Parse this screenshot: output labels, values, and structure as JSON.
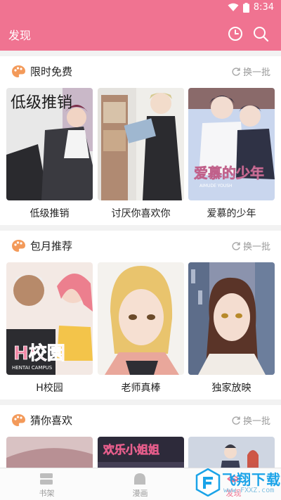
{
  "status": {
    "time": "8:34"
  },
  "app_bar": {
    "title": "发现"
  },
  "sections": [
    {
      "title": "限时免费",
      "refresh_label": "换一批",
      "items": [
        {
          "title": "低级推销",
          "cover_text": "低级推销"
        },
        {
          "title": "讨厌你喜欢你"
        },
        {
          "title": "爱慕的少年",
          "cover_text": "爱慕的少年",
          "cover_subtext": "AIMUDE YOUSH"
        }
      ]
    },
    {
      "title": "包月推荐",
      "refresh_label": "换一批",
      "items": [
        {
          "title": "H校园",
          "cover_text": "H校園",
          "cover_subtext": "HENTAI CAMPUS"
        },
        {
          "title": "老师真棒"
        },
        {
          "title": "独家放映"
        }
      ]
    },
    {
      "title": "猜你喜欢",
      "refresh_label": "换一批",
      "items": [
        {
          "title": ""
        },
        {
          "title": "",
          "cover_text": "欢乐小姐姐"
        },
        {
          "title": ""
        }
      ]
    }
  ],
  "tab_bar": {
    "tabs": [
      {
        "label": "书架",
        "icon": "bookshelf-icon"
      },
      {
        "label": "漫画",
        "icon": "comic-icon"
      },
      {
        "label": "发现",
        "icon": "discover-icon",
        "active": true
      }
    ]
  },
  "watermark": {
    "text": "飞翔下载",
    "url": "www.FXXZ.com"
  },
  "colors": {
    "accent": "#f07391",
    "text": "#222222",
    "muted": "#9a9a9a"
  }
}
